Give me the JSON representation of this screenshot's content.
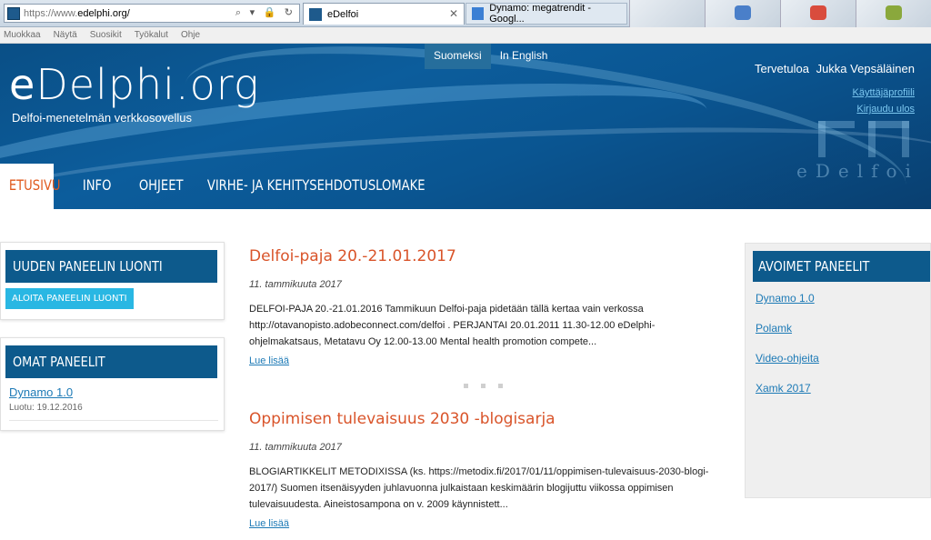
{
  "browser": {
    "url_prefix": "https://www.",
    "url_domain": "edelphi.org/",
    "url_controls": "⌕ ▾ 🔒 ↻",
    "tabs": [
      {
        "label": "eDelfoi",
        "close": "✕"
      },
      {
        "label": "Dynamo: megatrendit - Googl..."
      }
    ],
    "menu": [
      "Muokkaa",
      "Näytä",
      "Suosikit",
      "Työkalut",
      "Ohje"
    ]
  },
  "header": {
    "logo_e": "e",
    "logo_rest": "Delphi.org",
    "slogan": "Delfoi-menetelmän verkkosovellus",
    "watermark": "eDelfoi",
    "languages": [
      {
        "label": "Suomeksi",
        "selected": true
      },
      {
        "label": "In English",
        "selected": false
      }
    ],
    "welcome": "Tervetuloa",
    "user_name": "Jukka Vepsäläinen",
    "profile_link": "Käyttäjäprofiili",
    "logout_link": "Kirjaudu ulos"
  },
  "nav": {
    "items": [
      "ETUSIVU",
      "INFO",
      "OHJEET",
      "VIRHE- JA KEHITYSEHDOTUSLOMAKE"
    ]
  },
  "left": {
    "create_title": "UUDEN PANEELIN LUONTI",
    "create_button": "ALOITA PANEELIN LUONTI",
    "own_title": "OMAT PANEELIT",
    "own_panel_name": "Dynamo 1.0",
    "own_panel_meta": "Luotu: 19.12.2016"
  },
  "articles": [
    {
      "title": "Delfoi-paja 20.-21.01.2017",
      "date": "11. tammikuuta 2017",
      "body": "DELFOI-PAJA 20.-21.01.2016 Tammikuun Delfoi-paja pidetään tällä kertaa vain verkossa http://otavanopisto.adobeconnect.com/delfoi . PERJANTAI 20.01.2011 11.30-12.00 eDelphi-ohjelmakatsaus, Metatavu Oy 12.00-13.00 Mental health promotion compete...",
      "more": "Lue lisää"
    },
    {
      "title": "Oppimisen tulevaisuus 2030 -blogisarja",
      "date": "11. tammikuuta 2017",
      "body": "BLOGIARTIKKELIT METODIXISSA  (ks. https://metodix.fi/2017/01/11/oppimisen-tulevaisuus-2030-blogi-2017/) Suomen itsenäisyyden juhlavuonna julkaistaan keskimäärin blogijuttu viikossa oppimisen tulevaisuudesta. Aineistosampona on v. 2009 käynnistett...",
      "more": "Lue lisää"
    }
  ],
  "right": {
    "title": "AVOIMET PANEELIT",
    "panels": [
      "Dynamo 1.0",
      "Polamk",
      "Video-ohjeita",
      "Xamk 2017"
    ]
  }
}
